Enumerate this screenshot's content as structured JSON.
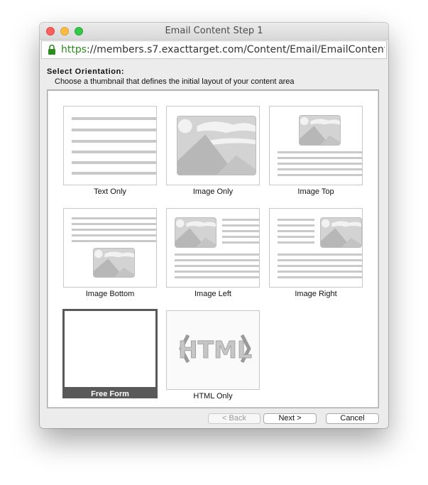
{
  "window": {
    "title": "Email Content Step 1",
    "url_scheme": "https",
    "url_rest": "://members.s7.exacttarget.com/Content/Email/EmailContent_St..."
  },
  "main": {
    "heading": "Select Orientation:",
    "subheading": "Choose a thumbnail that defines the initial layout of your content area",
    "tiles": [
      {
        "label": "Text Only"
      },
      {
        "label": "Image Only"
      },
      {
        "label": "Image Top"
      },
      {
        "label": "Image Bottom"
      },
      {
        "label": "Image Left"
      },
      {
        "label": "Image Right"
      },
      {
        "label": "Free Form",
        "selected": true
      },
      {
        "label": "HTML Only",
        "thumb_text": "HTML"
      }
    ]
  },
  "buttons": {
    "back": "< Back",
    "next": "Next >",
    "cancel": "Cancel"
  },
  "colors": {
    "close": "#fc605c",
    "minimize": "#fdbc40",
    "maximize": "#34c84a",
    "secure_url": "#2e8b1f",
    "selected": "#595959"
  }
}
